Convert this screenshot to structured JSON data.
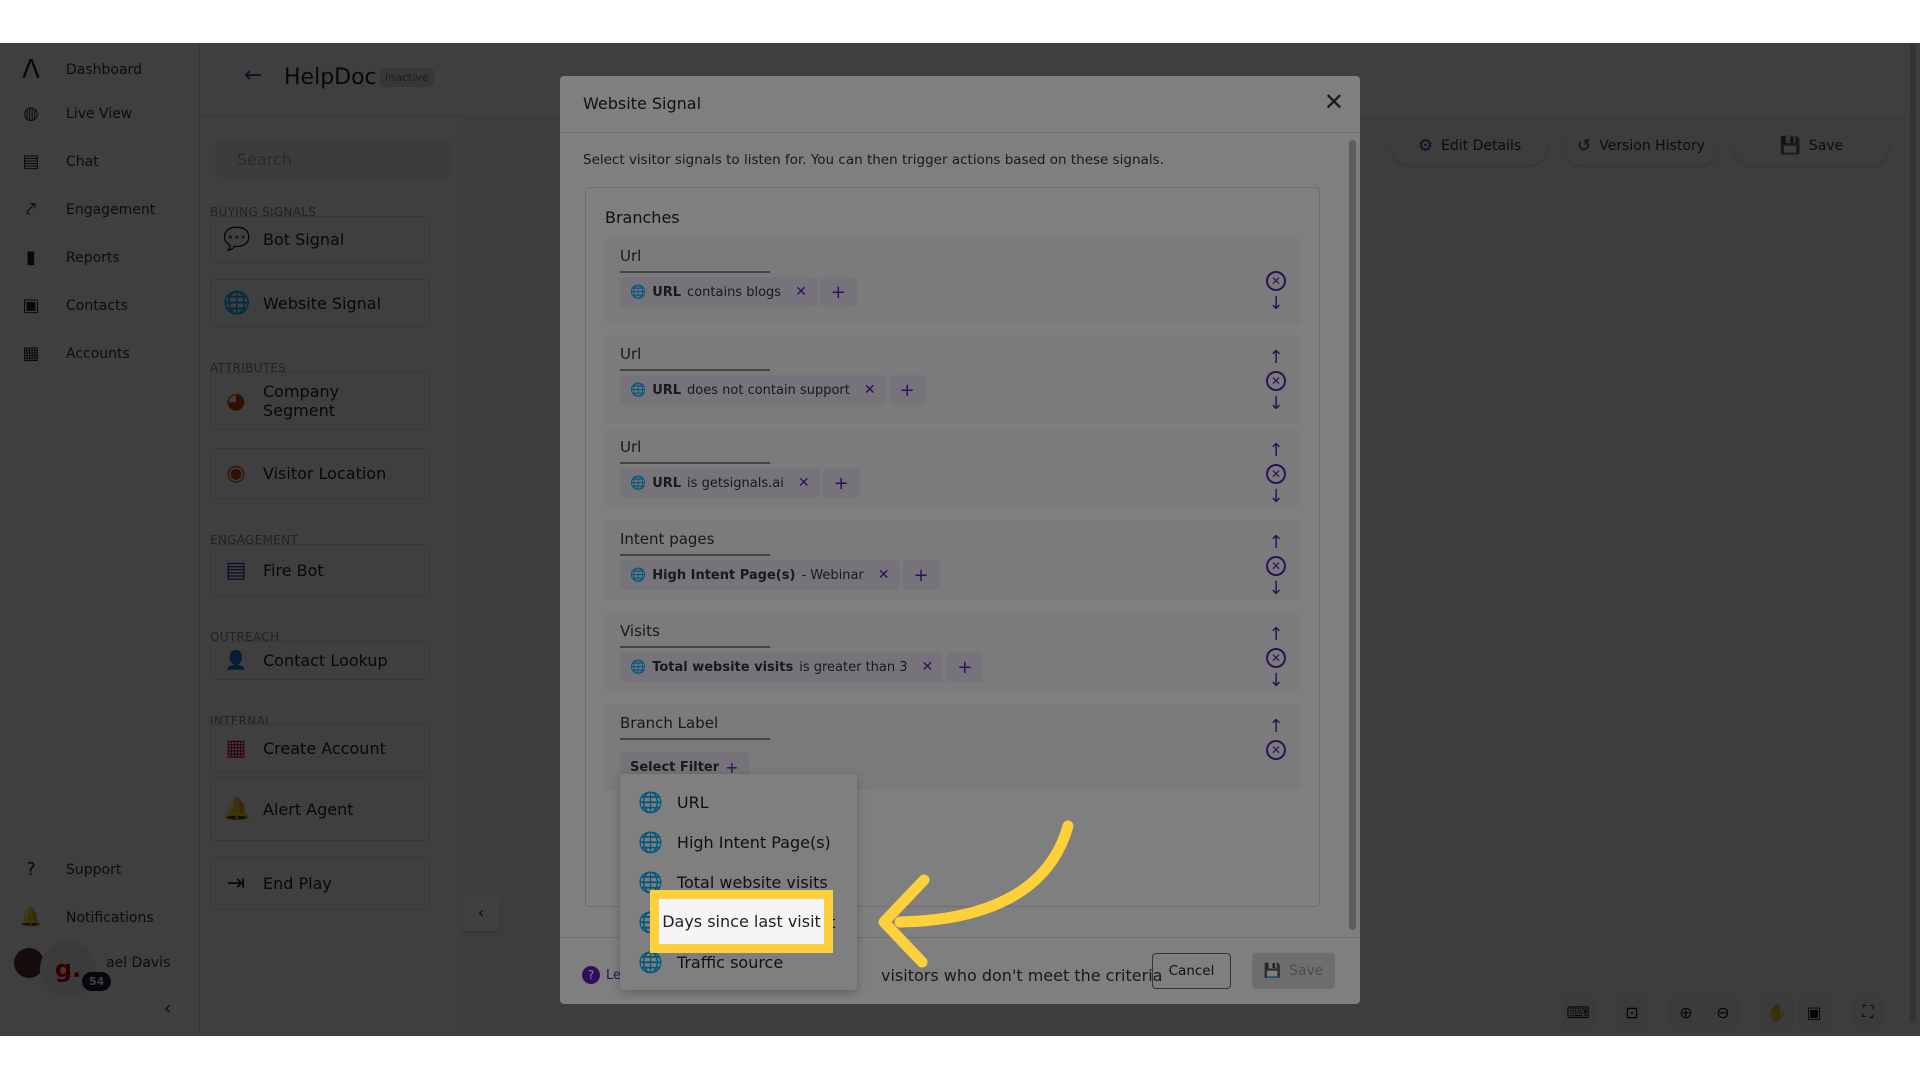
{
  "nav": {
    "items": [
      {
        "label": "Dashboard",
        "icon": "logo-icon"
      },
      {
        "label": "Live View",
        "icon": "live-view-icon"
      },
      {
        "label": "Chat",
        "icon": "chat-icon"
      },
      {
        "label": "Engagement",
        "icon": "engagement-icon"
      },
      {
        "label": "Reports",
        "icon": "reports-icon"
      },
      {
        "label": "Contacts",
        "icon": "contacts-icon"
      },
      {
        "label": "Accounts",
        "icon": "accounts-icon"
      }
    ],
    "bottom": [
      {
        "label": "Support"
      },
      {
        "label": "Notifications"
      }
    ],
    "user": {
      "name": "ael Davis",
      "widget_letter": "g.",
      "badge": "54"
    }
  },
  "header": {
    "title": "HelpDoc",
    "status": "Inactive"
  },
  "panel": {
    "search_placeholder": "Search",
    "sections": {
      "buying": "BUYING SIGNALS",
      "attributes": "ATTRIBUTES",
      "engagement": "ENGAGEMENT",
      "outreach": "OUTREACH",
      "internal": "INTERNAL"
    },
    "cards": [
      "Bot Signal",
      "Website Signal",
      "Company Segment",
      "Visitor Location",
      "Fire Bot",
      "Contact Lookup",
      "Create Account",
      "Alert Agent",
      "End Play"
    ]
  },
  "toolbar": {
    "edit": "Edit Details",
    "history": "Version History",
    "save": "Save"
  },
  "modal": {
    "title": "Website Signal",
    "description": "Select visitor signals to listen for. You can then trigger actions based on these signals.",
    "branches_title": "Branches",
    "branches": [
      {
        "label": "Url",
        "chip_bold": "URL",
        "chip_rest": "contains blogs"
      },
      {
        "label": "Url",
        "chip_bold": "URL",
        "chip_rest": "does not contain support"
      },
      {
        "label": "Url",
        "chip_bold": "URL",
        "chip_rest": "is getsignals.ai"
      },
      {
        "label": "Intent pages",
        "chip_bold": "High Intent Page(s)",
        "chip_rest": "- Webinar"
      },
      {
        "label": "Visits",
        "chip_bold": "Total website visits",
        "chip_rest": "is greater than 3"
      },
      {
        "label": "Branch Label",
        "select_filter": "Select Filter"
      }
    ],
    "checkbox_text": "visitors who don't meet the criteria",
    "learn": "Le",
    "cancel": "Cancel",
    "save": "Save"
  },
  "dropdown": {
    "items": [
      "URL",
      "High Intent Page(s)",
      "Total website visits",
      "Days since last visit",
      "Traffic source"
    ],
    "highlighted": "Days since last visit"
  },
  "colors": {
    "accent": "#5b21b6",
    "highlight": "#fdd13b"
  }
}
